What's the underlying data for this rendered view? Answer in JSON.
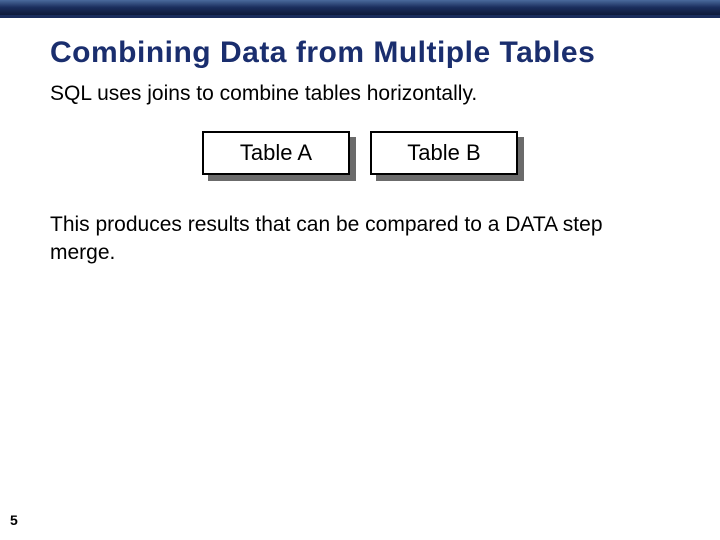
{
  "slide": {
    "title": "Combining Data from Multiple Tables",
    "intro": "SQL uses joins to combine tables horizontally.",
    "boxes": {
      "a": "Table A",
      "b": "Table B"
    },
    "conclusion": "This produces results that can be compared to a DATA step merge.",
    "page_number": "5"
  }
}
